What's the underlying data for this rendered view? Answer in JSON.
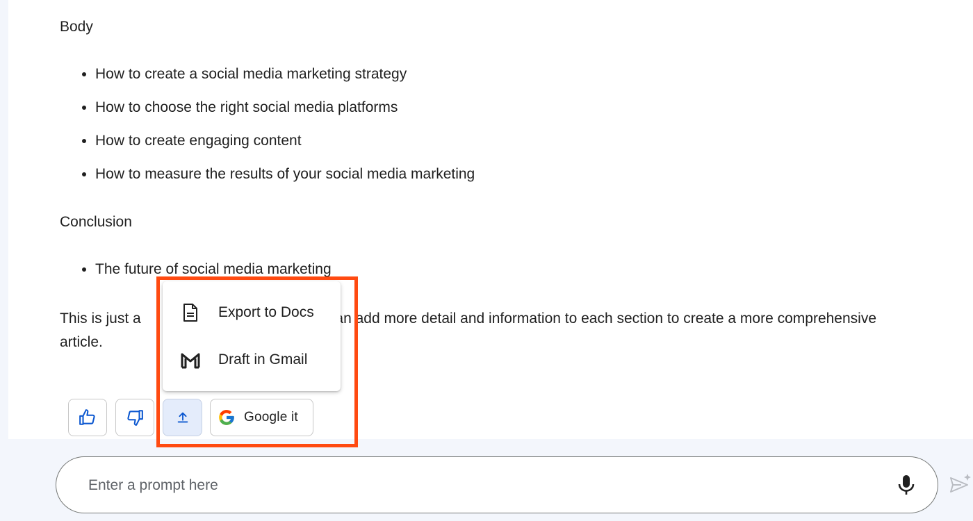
{
  "response": {
    "body_heading": "Body",
    "body_items": [
      "How to create a social media marketing strategy",
      "How to choose the right social media platforms",
      "How to create engaging content",
      "How to measure the results of your social media marketing"
    ],
    "conclusion_heading": "Conclusion",
    "conclusion_items": [
      "The future of social media marketing"
    ],
    "summary_start": "This is just a",
    "summary_end": "ou can add more detail and information to each section to create a more comprehensive",
    "summary_line2": "article."
  },
  "actions": {
    "google_label": "Google it"
  },
  "export_menu": {
    "items": [
      {
        "label": "Export to Docs",
        "icon": "docs-icon"
      },
      {
        "label": "Draft in Gmail",
        "icon": "gmail-icon"
      }
    ]
  },
  "prompt": {
    "placeholder": "Enter a prompt here",
    "value": ""
  },
  "colors": {
    "accent_blue": "#0b57d0",
    "highlight": "#ff4a11",
    "share_active_bg": "#e4ecfb"
  }
}
